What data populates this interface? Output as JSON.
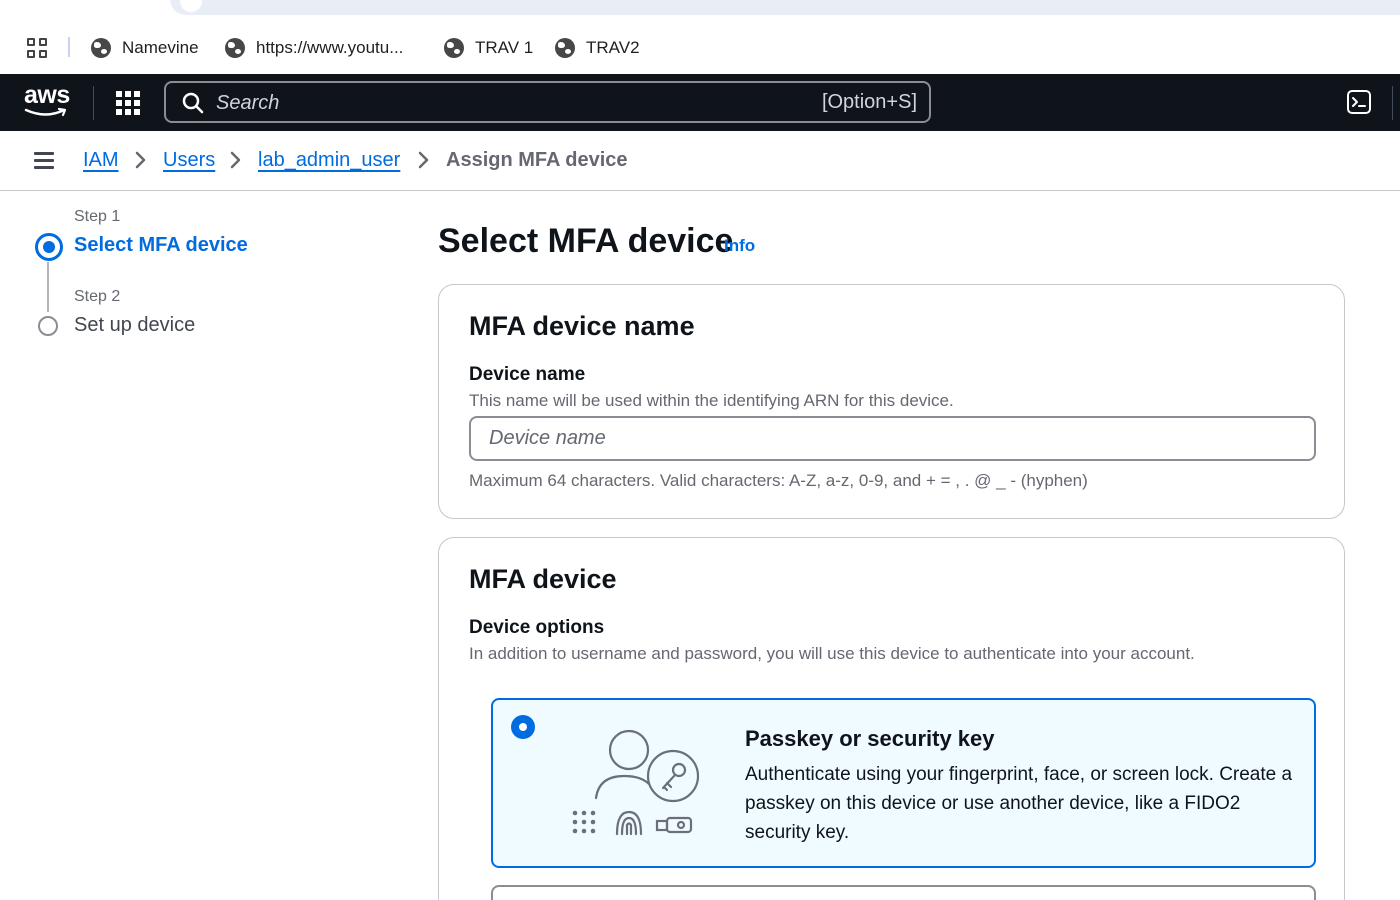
{
  "bookmarks": [
    {
      "label": "Namevine",
      "icon": "globe-icon"
    },
    {
      "label": "https://www.youtu...",
      "icon": "globe-icon"
    },
    {
      "label": "TRAV 1",
      "icon": "globe-icon"
    },
    {
      "label": "TRAV2",
      "icon": "globe-icon"
    }
  ],
  "topnav": {
    "logo": "aws",
    "search_placeholder": "Search",
    "search_shortcut": "[Option+S]"
  },
  "breadcrumb": {
    "items": [
      "IAM",
      "Users",
      "lab_admin_user"
    ],
    "current": "Assign MFA device"
  },
  "steps": [
    {
      "label": "Step 1",
      "title": "Select MFA device",
      "state": "active"
    },
    {
      "label": "Step 2",
      "title": "Set up device",
      "state": "pending"
    }
  ],
  "page": {
    "title": "Select MFA device",
    "info": "Info"
  },
  "name_panel": {
    "title": "MFA device name",
    "field_label": "Device name",
    "field_desc": "This name will be used within the identifying ARN for this device.",
    "placeholder": "Device name",
    "value": "",
    "constraint": "Maximum 64 characters. Valid characters: A-Z, a-z, 0-9, and + = , . @ _ - (hyphen)"
  },
  "device_panel": {
    "title": "MFA device",
    "field_label": "Device options",
    "field_desc": "In addition to username and password, you will use this device to authenticate into your account.",
    "options": [
      {
        "title": "Passkey or security key",
        "desc": "Authenticate using your fingerprint, face, or screen lock. Create a passkey on this device or use another device, like a FIDO2 security key.",
        "selected": true
      }
    ]
  },
  "colors": {
    "accent": "#006ce0",
    "nav_bg": "#0f141a",
    "selected_bg": "#f0fbff"
  }
}
